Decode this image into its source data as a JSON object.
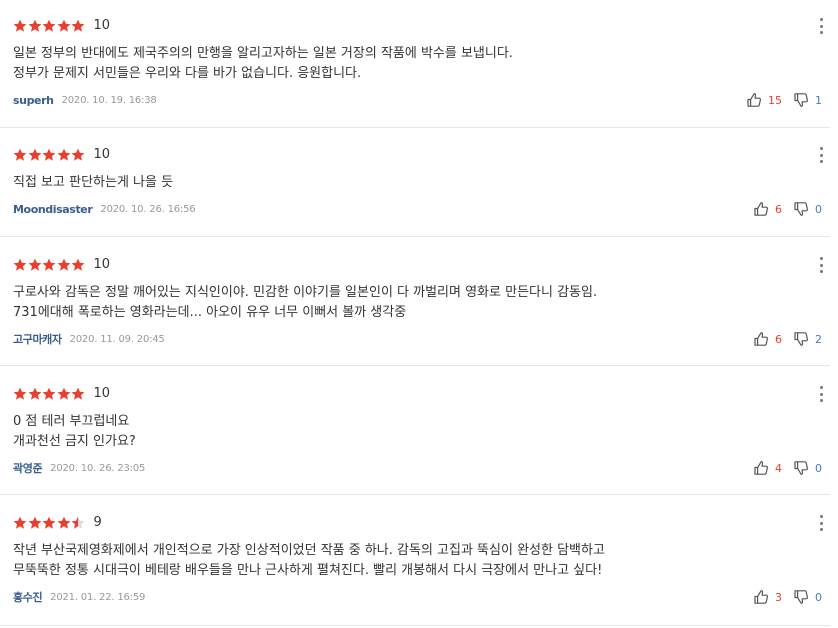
{
  "colors": {
    "star": "#e8402e",
    "star_empty": "#d9d9d9",
    "author": "#3a5e8c",
    "like_count": "#e8402e",
    "dislike_count": "#4a78c2",
    "text": "#333333",
    "date": "#999999"
  },
  "icons": {
    "star": "star-icon",
    "more": "more-vertical-icon",
    "like": "thumbs-up-icon",
    "dislike": "thumbs-down-icon"
  },
  "reviews": [
    {
      "rating": 10,
      "score": "10",
      "lines": [
        "일본 정부의 반대에도 제국주의의 만행을 알리고자하는 일본 거장의 작품에 박수를 보냅니다.",
        "정부가 문제지 서민들은 우리와 다를 바가 없습니다. 응원합니다."
      ],
      "author": "superh",
      "date": "2020. 10. 19. 16:38",
      "likes": "15",
      "dislikes": "1"
    },
    {
      "rating": 10,
      "score": "10",
      "lines": [
        "직접 보고 판단하는게 나을 듯"
      ],
      "author": "Moondisaster",
      "date": "2020. 10. 26. 16:56",
      "likes": "6",
      "dislikes": "0"
    },
    {
      "rating": 10,
      "score": "10",
      "lines": [
        "구로사와 감독은 정말 깨어있는 지식인이야. 민감한 이야기를 일본인이 다 까벌리며 영화로 만든다니 감동임.",
        "731에대해 폭로하는 영화라는데... 아오이 유우 너무 이뻐서 볼까 생각중"
      ],
      "author": "고구마캐자",
      "date": "2020. 11. 09. 20:45",
      "likes": "6",
      "dislikes": "2"
    },
    {
      "rating": 10,
      "score": "10",
      "lines": [
        "0 점 테러 부끄럽네요",
        "개과천선 금지 인가요?"
      ],
      "author": "곽영준",
      "date": "2020. 10. 26. 23:05",
      "likes": "4",
      "dislikes": "0"
    },
    {
      "rating": 9,
      "score": "9",
      "lines": [
        "작년 부산국제영화제에서 개인적으로 가장 인상적이었던 작품 중 하나. 감독의 고집과 뚝심이 완성한 담백하고",
        "무뚝뚝한 정통 시대극이 베테랑 배우들을 만나 근사하게 펼쳐진다. 빨리 개봉해서 다시 극장에서 만나고 싶다!"
      ],
      "author": "홍수진",
      "date": "2021. 01. 22. 16:59",
      "likes": "3",
      "dislikes": "0"
    }
  ]
}
